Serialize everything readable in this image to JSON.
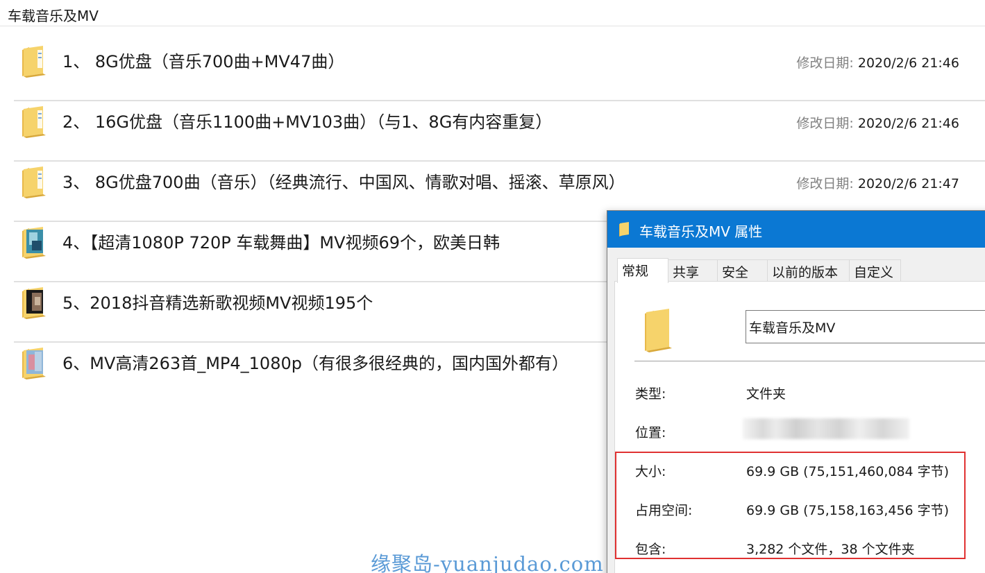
{
  "window": {
    "title": "车载音乐及MV"
  },
  "folders": [
    {
      "name": "1、 8G优盘（音乐700曲+MV47曲）",
      "date_label": "修改日期:",
      "date": "2020/2/6 21:46",
      "icon": "folder-icon"
    },
    {
      "name": "2、 16G优盘（音乐1100曲+MV103曲）（与1、8G有内容重复）",
      "date_label": "修改日期:",
      "date": "2020/2/6 21:46",
      "icon": "folder-icon"
    },
    {
      "name": "3、 8G优盘700曲（音乐）（经典流行、中国风、情歌对唱、摇滚、草原风）",
      "date_label": "修改日期:",
      "date": "2020/2/6 21:47",
      "icon": "folder-icon"
    },
    {
      "name": "4、【超清1080P 720P 车载舞曲】MV视频69个，欧美日韩",
      "icon": "folder-thumbnail-icon"
    },
    {
      "name": "5、2018抖音精选新歌视频MV视频195个",
      "icon": "folder-thumbnail-icon"
    },
    {
      "name": "6、MV高清263首_MP4_1080p（有很多很经典的，国内国外都有）",
      "icon": "folder-thumbnail-icon"
    }
  ],
  "dialog": {
    "title": "车载音乐及MV 属性",
    "tabs": [
      "常规",
      "共享",
      "安全",
      "以前的版本",
      "自定义"
    ],
    "active_tab": "常规",
    "name_value": "车载音乐及MV",
    "type_label": "类型:",
    "type_value": "文件夹",
    "location_label": "位置:",
    "size_label": "大小:",
    "size_value": "69.9 GB (75,151,460,084 字节)",
    "disk_label": "占用空间:",
    "disk_value": "69.9 GB (75,158,163,456 字节)",
    "contains_label": "包含:",
    "contains_value": "3,282 个文件，38 个文件夹"
  },
  "watermark": "缘聚岛-yuanjudao.com",
  "colors": {
    "title_bar": "#0b78d3",
    "folder_yellow": "#f6d36b",
    "highlight": "#e03131",
    "watermark": "#5a9ad6"
  }
}
